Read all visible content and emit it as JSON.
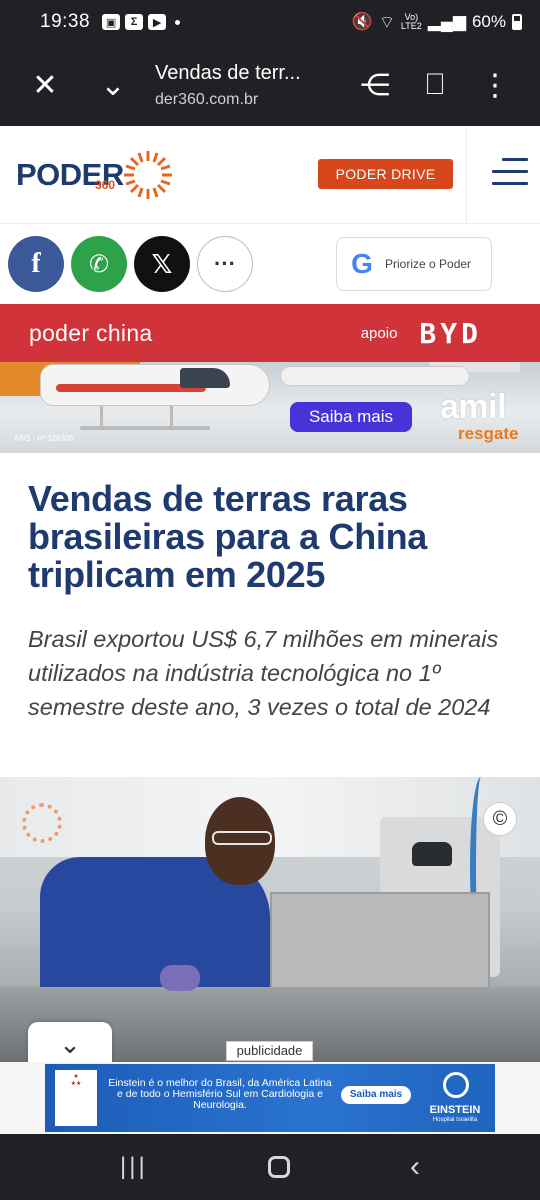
{
  "status_bar": {
    "time": "19:38",
    "network": "LTE2",
    "network_top": "Vo)",
    "battery": "60%"
  },
  "browser": {
    "tab_title": "Vendas de terr...",
    "url": "der360.com.br"
  },
  "site": {
    "logo": "PODER",
    "logo_sub": "360",
    "drive_button": "PODER DRIVE"
  },
  "share": {
    "priorize_label": "Priorize o Poder",
    "google_letter": "G",
    "more_label": "···"
  },
  "section": {
    "title": "poder china",
    "apoio": "apoio",
    "sponsor": "BYD"
  },
  "ad_top": {
    "ans": "ANS - nº 326305",
    "cta": "Saiba mais",
    "brand": "amil",
    "brand_sub": "resgate"
  },
  "article": {
    "headline": "Vendas de terras raras brasileiras para a China triplicam em 2025",
    "subheadline": "Brasil exportou US$ 6,7 milhões em minerais utilizados na indústria tecnológica no 1º semestre deste ano, 3 vezes o total de 2024"
  },
  "photo": {
    "copyright_symbol": "©"
  },
  "ad_bottom": {
    "label": "publicidade",
    "text": "Einstein é o melhor do Brasil, da América Latina e de todo o Hemisfério Sul em Cardiologia e Neurologia.",
    "cta": "Saiba mais",
    "brand": "EINSTEIN",
    "brand_sub": "Hospital Israelita"
  }
}
